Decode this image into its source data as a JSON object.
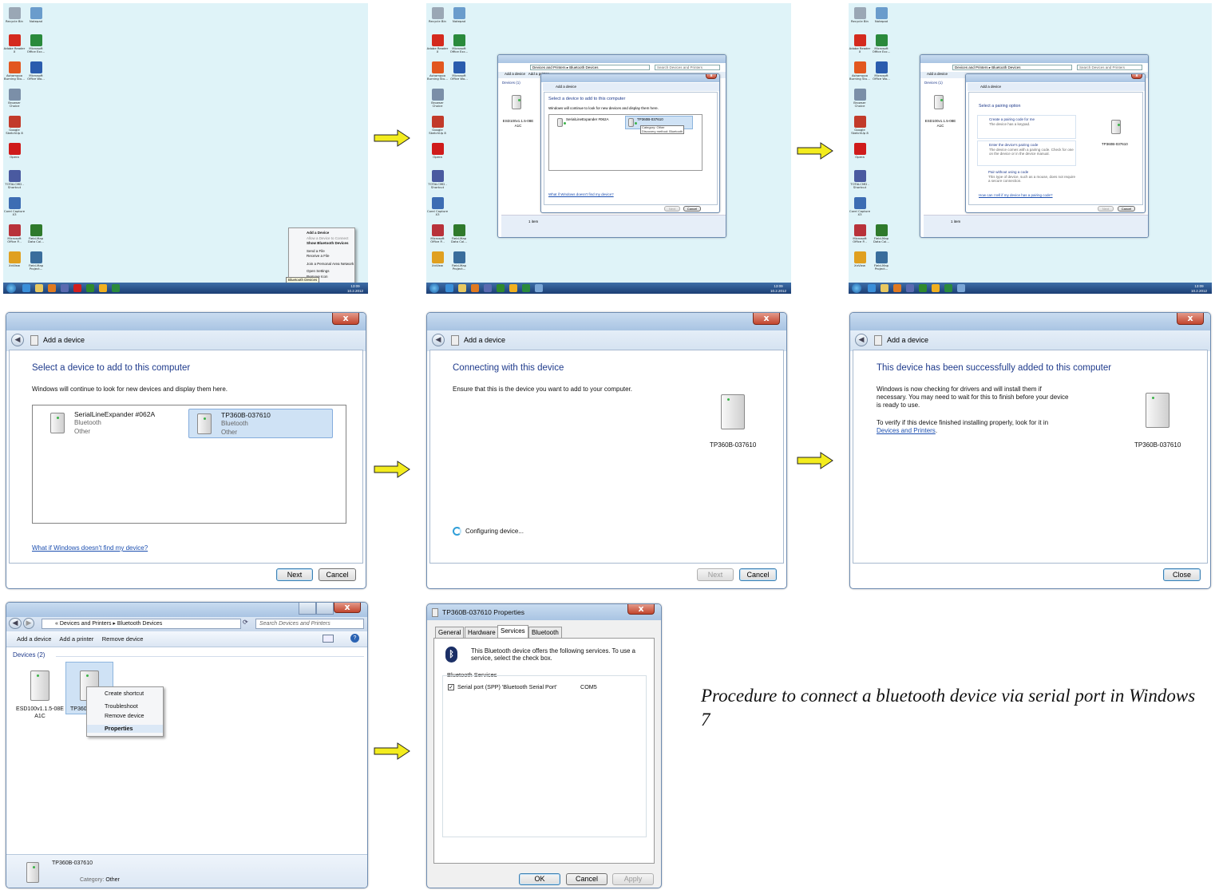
{
  "desktop": {
    "icons": [
      {
        "label": "Recycle Bin",
        "color": "#9aa7b5"
      },
      {
        "label": "Notepad",
        "color": "#6a9ccc"
      },
      {
        "label": "Adobe Reader X",
        "color": "#d42a1e"
      },
      {
        "label": "Microsoft Office Exc...",
        "color": "#2a8a3c"
      },
      {
        "label": "Ashampoo Burning Stu...",
        "color": "#e2571f"
      },
      {
        "label": "Microsoft Office Wo...",
        "color": "#2a5cae"
      },
      {
        "label": "Browser Choice",
        "color": "#7b8fa8"
      },
      {
        "label": "Google SketchUp 8",
        "color": "#c23a2a"
      },
      {
        "label": "Opera",
        "color": "#cf1b1b"
      },
      {
        "label": "TOTALCMD - Shortcut",
        "color": "#4a5aa0"
      },
      {
        "label": "Corel Capture X3",
        "color": "#3d6db3"
      },
      {
        "label": "Microsoft Office P...",
        "color": "#b8323a"
      },
      {
        "label": "Field-Map Data Col...",
        "color": "#2f7a2c"
      },
      {
        "label": "XnView",
        "color": "#e0a020"
      },
      {
        "label": "Field-Map Project...",
        "color": "#3a6d9c"
      }
    ],
    "tray_menu": {
      "items": [
        "Add a Device",
        "Allow a Device to Connect",
        "Show Bluetooth Devices",
        "Send a File",
        "Receive a File",
        "Join a Personal Area Network",
        "Open Settings",
        "Remove Icon"
      ],
      "tooltip": "Bluetooth Devices"
    },
    "clock": {
      "time": "13:09",
      "date": "10.2.2012"
    }
  },
  "thumb2": {
    "breadcrumb": "Devices and Printers ▸ Bluetooth Devices",
    "search": "Search Devices and Printers",
    "toolbar": [
      "Add a device",
      "Add a printer"
    ],
    "group": "Devices (1)",
    "device": "ESD100v1.1.5-08E A1C",
    "status": "1 item",
    "dialog_title": "Add a device",
    "heading": "Select a device to add to this computer",
    "subtext": "Windows will continue to look for new devices and display them here.",
    "dev1": "SerialLineExpander #062A",
    "dev2": "TP360B-037610",
    "tooltip": [
      "Category: Other",
      "Discovery method: Bluetooth"
    ],
    "link": "What if Windows doesn't find my device?",
    "next": "Next",
    "cancel": "Cancel"
  },
  "thumb3": {
    "heading": "Select a pairing option",
    "opt1": "Create a pairing code for me",
    "opt1s": "The device has a keypad.",
    "opt2": "Enter the device's pairing code",
    "opt2s": "The device comes with a pairing code. Check for one on the device or in the device manual.",
    "opt3": "Pair without using a code",
    "opt3s": "This type of device, such as a mouse, does not require a secure connection.",
    "link": "How can I tell if my device has a pairing code?",
    "device": "TP360B-037610"
  },
  "dialog_a": {
    "title": "Add a device",
    "heading": "Select a device to add to this computer",
    "subtext": "Windows will continue to look for new devices and display them here.",
    "devices": [
      {
        "name": "SerialLineExpander #062A",
        "type": "Bluetooth",
        "cat": "Other"
      },
      {
        "name": "TP360B-037610",
        "type": "Bluetooth",
        "cat": "Other"
      }
    ],
    "link": "What if Windows doesn't find my device?",
    "next": "Next",
    "cancel": "Cancel"
  },
  "dialog_b": {
    "title": "Add a device",
    "heading": "Connecting with this device",
    "subtext": "Ensure that this is the device you want to add to your computer.",
    "device": "TP360B-037610",
    "status": "Configuring device...",
    "next": "Next",
    "cancel": "Cancel"
  },
  "dialog_c": {
    "title": "Add a device",
    "heading": "This device has been successfully added to this computer",
    "line1": "Windows is now checking for drivers and will install them if",
    "line2": "necessary. You may need to wait for this to finish before your device",
    "line3": "is ready to use.",
    "line4": "To verify if this device finished installing properly, look for it in",
    "link": "Devices and Printers",
    "link_tail": ".",
    "device": "TP360B-037610",
    "close": "Close"
  },
  "explorer": {
    "breadcrumb_sep": "«",
    "crumb1": "Devices and Printers",
    "crumb_arrow": "▸",
    "crumb2": "Bluetooth Devices",
    "search": "Search Devices and Printers",
    "toolbar": [
      "Add a device",
      "Add a printer",
      "Remove device"
    ],
    "group": "Devices (2)",
    "device1": "ESD100v1.1.5-08E A1C",
    "device2": "TP360",
    "context": [
      "Create shortcut",
      "Troubleshoot",
      "Remove device",
      "Properties"
    ],
    "details_name": "TP360B-037610",
    "details_cat_label": "Category:",
    "details_cat": "Other"
  },
  "properties": {
    "title": "TP360B-037610 Properties",
    "tabs": [
      "General",
      "Hardware",
      "Services",
      "Bluetooth"
    ],
    "info": "This Bluetooth device offers the following services. To use a service, select the check box.",
    "group": "Bluetooth Services",
    "service": "Serial port (SPP) 'Bluetooth Serial Port'",
    "port": "COM5",
    "ok": "OK",
    "cancel": "Cancel",
    "apply": "Apply"
  },
  "caption": "Procedure to connect a bluetooth device via serial port in Windows 7",
  "colors": {
    "arrow": "#f3ec1e",
    "arrow_stroke": "#222222",
    "heading": "#1f3b8c",
    "link": "#1c4fb0",
    "selection": "#cfe2f5"
  }
}
